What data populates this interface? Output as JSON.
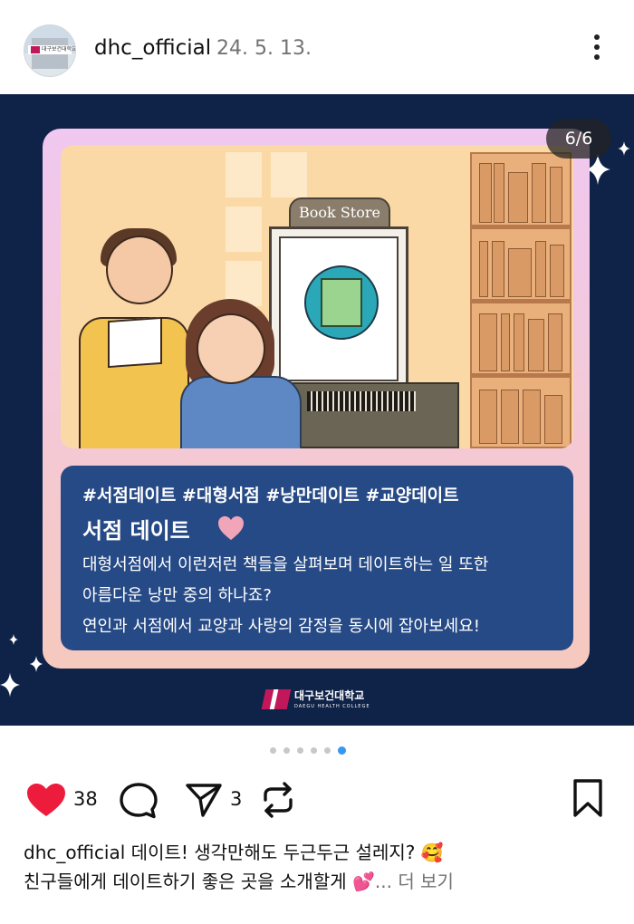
{
  "post": {
    "username": "dhc_official",
    "date": "24. 5. 13.",
    "avatar_text": "대구보건대학교"
  },
  "image": {
    "slide_counter": "6/6",
    "kiosk_sign": "Book Store",
    "hashtags": "#서점데이트 #대형서점 #낭만데이트 #교양데이트",
    "title": "서점 데이트",
    "lines": [
      "대형서점에서 이런저런 책들을 살펴보며 데이트하는 일 또한",
      "아름다운 낭만 중의 하나죠?",
      "연인과 서점에서 교양과 사랑의 감정을 동시에 잡아보세요!"
    ],
    "college_name": "대구보건대학교",
    "college_sub": "DAEGU HEALTH COLLEGE"
  },
  "pager": {
    "total": 6,
    "active_index": 5
  },
  "actions": {
    "like_count": "38",
    "share_count": "3",
    "like_color": "#ed1c3d"
  },
  "caption": {
    "username": "dhc_official",
    "line1": "데이트! 생각만해도 두근두근 설레지? 🥰",
    "line2": "친구들에게 데이트하기 좋은 곳을 소개할게 💕",
    "ellipsis": "...",
    "more": "더 보기"
  },
  "icons": {
    "more": "more-vertical-icon",
    "like": "heart-filled-icon",
    "comment": "comment-icon",
    "share": "send-icon",
    "repost": "repost-icon",
    "save": "bookmark-icon"
  }
}
